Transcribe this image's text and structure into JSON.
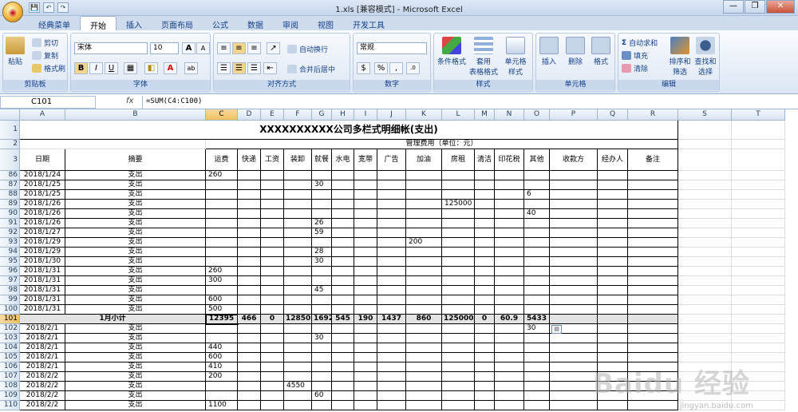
{
  "window": {
    "title": "1.xls [兼容模式] - Microsoft Excel",
    "qat": [
      "💾",
      "↶",
      "↷"
    ],
    "controls": [
      "—",
      "❐",
      "✕"
    ]
  },
  "tabs": [
    "经典菜单",
    "开始",
    "插入",
    "页面布局",
    "公式",
    "数据",
    "审阅",
    "视图",
    "开发工具"
  ],
  "active_tab": "开始",
  "ribbon": {
    "clipboard": {
      "label": "剪贴板",
      "paste": "粘贴",
      "cut": "剪切",
      "copy": "复制",
      "format_painter": "格式刷"
    },
    "font": {
      "label": "字体",
      "name": "宋体",
      "size": "10",
      "bold": "B",
      "italic": "I",
      "underline": "U",
      "grow": "A",
      "shrink": "A"
    },
    "alignment": {
      "label": "对齐方式",
      "wrap": "自动换行",
      "merge": "合并后居中"
    },
    "number": {
      "label": "数字",
      "format": "常规",
      "percent": "%",
      "comma": ","
    },
    "styles": {
      "label": "样式",
      "conditional": "条件格式",
      "table": "套用\n表格格式",
      "cell": "单元格\n样式"
    },
    "cells": {
      "label": "单元格",
      "insert": "插入",
      "delete": "删除",
      "format": "格式"
    },
    "editing": {
      "label": "编辑",
      "autosum": "自动求和",
      "fill": "填充",
      "clear": "清除",
      "sort": "排序和\n筛选",
      "find": "查找和\n选择"
    }
  },
  "formula_bar": {
    "name_box": "C101",
    "fx": "fx",
    "formula": "=SUM(C4:C100)"
  },
  "columns": [
    "A",
    "B",
    "C",
    "D",
    "E",
    "F",
    "G",
    "H",
    "I",
    "J",
    "K",
    "L",
    "M",
    "N",
    "O",
    "P",
    "Q",
    "R",
    "S",
    "T"
  ],
  "selected_column": "C",
  "selected_row": "101",
  "sheet": {
    "title": "XXXXXXXXXX公司多栏式明细帐(支出)",
    "subtitle": "管理费用（单位：元）",
    "headers": [
      "日期",
      "摘要",
      "运费",
      "快递",
      "工资",
      "装卸",
      "就餐",
      "水电",
      "宽带",
      "广告",
      "加油",
      "房租",
      "清洁",
      "印花税",
      "其他",
      "收款方",
      "经办人",
      "备注"
    ],
    "rows": [
      {
        "n": "86",
        "d": "2018/1/24",
        "s": "支出",
        "v": {
          "2": "260"
        }
      },
      {
        "n": "87",
        "d": "2018/1/25",
        "s": "支出",
        "v": {
          "6": "30"
        }
      },
      {
        "n": "88",
        "d": "2018/1/25",
        "s": "支出",
        "v": {
          "14": "6"
        }
      },
      {
        "n": "89",
        "d": "2018/1/26",
        "s": "支出",
        "v": {
          "11": "125000"
        }
      },
      {
        "n": "90",
        "d": "2018/1/26",
        "s": "支出",
        "v": {
          "14": "40"
        }
      },
      {
        "n": "91",
        "d": "2018/1/26",
        "s": "支出",
        "v": {
          "6": "26"
        }
      },
      {
        "n": "92",
        "d": "2018/1/27",
        "s": "支出",
        "v": {
          "6": "59"
        }
      },
      {
        "n": "93",
        "d": "2018/1/29",
        "s": "支出",
        "v": {
          "10": "200"
        }
      },
      {
        "n": "94",
        "d": "2018/1/29",
        "s": "支出",
        "v": {
          "6": "28"
        }
      },
      {
        "n": "95",
        "d": "2018/1/30",
        "s": "支出",
        "v": {
          "6": "30"
        }
      },
      {
        "n": "96",
        "d": "2018/1/31",
        "s": "支出",
        "v": {
          "2": "260"
        }
      },
      {
        "n": "97",
        "d": "2018/1/31",
        "s": "支出",
        "v": {
          "2": "300"
        }
      },
      {
        "n": "98",
        "d": "2018/1/31",
        "s": "支出",
        "v": {
          "6": "45"
        }
      },
      {
        "n": "99",
        "d": "2018/1/31",
        "s": "支出",
        "v": {
          "2": "600"
        }
      },
      {
        "n": "100",
        "d": "2018/1/31",
        "s": "支出",
        "v": {
          "2": "500"
        }
      },
      {
        "n": "101",
        "sum": true,
        "label": "1月小计",
        "v": {
          "2": "12395",
          "3": "466",
          "4": "0",
          "5": "12850",
          "6": "1692",
          "7": "545",
          "8": "190",
          "9": "1437",
          "10": "860",
          "11": "125000",
          "12": "0",
          "13": "60.9",
          "14": "5433"
        }
      },
      {
        "n": "102",
        "d": "2018/2/1",
        "s": "支出",
        "v": {
          "14": "30"
        }
      },
      {
        "n": "103",
        "d": "2018/2/1",
        "s": "支出",
        "v": {
          "6": "30"
        }
      },
      {
        "n": "104",
        "d": "2018/2/1",
        "s": "支出",
        "v": {
          "2": "440"
        }
      },
      {
        "n": "105",
        "d": "2018/2/1",
        "s": "支出",
        "v": {
          "2": "600"
        }
      },
      {
        "n": "106",
        "d": "2018/2/1",
        "s": "支出",
        "v": {
          "2": "410"
        }
      },
      {
        "n": "107",
        "d": "2018/2/2",
        "s": "支出",
        "v": {
          "2": "200"
        }
      },
      {
        "n": "108",
        "d": "2018/2/2",
        "s": "支出",
        "v": {
          "5": "4550"
        }
      },
      {
        "n": "109",
        "d": "2018/2/2",
        "s": "支出",
        "v": {
          "6": "60"
        }
      },
      {
        "n": "110",
        "d": "2018/2/2",
        "s": "支出",
        "v": {
          "2": "1100"
        }
      }
    ]
  },
  "watermark": {
    "main": "Baidu 经验",
    "sub": "jingyan.baidu.com"
  },
  "colors": {
    "accent": "#15428b",
    "selected_header": "#f1c15f",
    "sum_row": "#e3e3e3"
  }
}
